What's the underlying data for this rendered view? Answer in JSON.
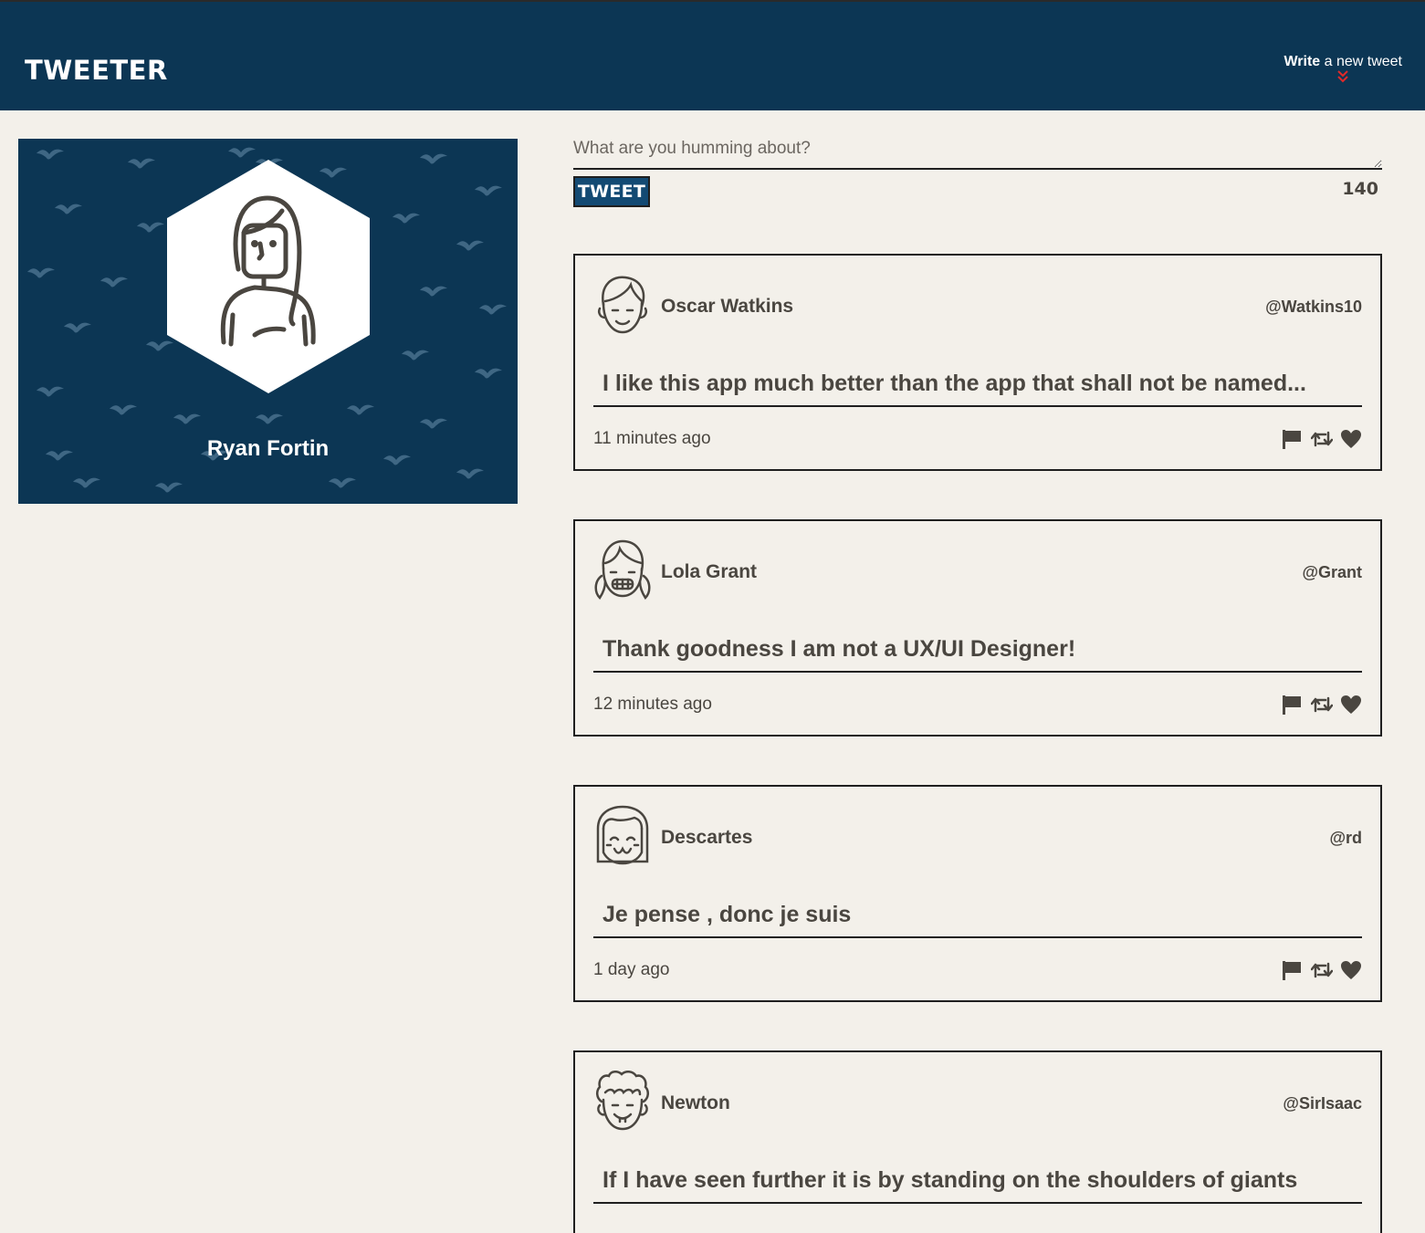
{
  "app": {
    "logo": "TWEETER",
    "compose_link": {
      "bold": "Write",
      "rest": " a new tweet"
    }
  },
  "profile": {
    "name": "Ryan Fortin"
  },
  "composer": {
    "placeholder": "What are you humming about?",
    "button_label": "TWEET",
    "counter": "140"
  },
  "tweets": [
    {
      "name": "Oscar Watkins",
      "handle": "@Watkins10",
      "content": "I like this app much better than the app that shall not be named...",
      "time": "11 minutes ago",
      "avatar_icon": "boy-avatar-icon"
    },
    {
      "name": "Lola Grant",
      "handle": "@Grant",
      "content": "Thank goodness I am not a UX/UI Designer!",
      "time": "12 minutes ago",
      "avatar_icon": "girl-pigtails-avatar-icon"
    },
    {
      "name": "Descartes",
      "handle": "@rd",
      "content": "Je pense , donc je suis",
      "time": "1 day ago",
      "avatar_icon": "bob-hair-avatar-icon"
    },
    {
      "name": "Newton",
      "handle": "@SirIsaac",
      "content": "If I have seen further it is by standing on the shoulders of giants",
      "time": "",
      "avatar_icon": "curly-hair-avatar-icon"
    }
  ],
  "colors": {
    "header_bg": "#0c3654",
    "page_bg": "#f3f0ea",
    "text": "#4a4640",
    "accent_red": "#e02a2a",
    "button_bg": "#134a73"
  }
}
